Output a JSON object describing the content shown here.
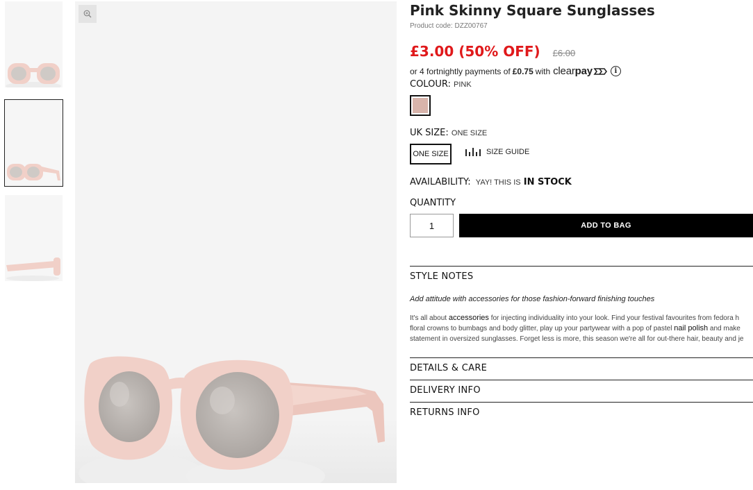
{
  "product": {
    "title": "Pink Skinny Square Sunglasses",
    "code_label": "Product code: DZZ00767",
    "price_now": "£3.00 (50% OFF)",
    "price_was": "£6.00"
  },
  "clearpay": {
    "prefix": "or 4 fortnightly payments of",
    "amount": "£0.75",
    "suffix": "with",
    "brand_light": "clear",
    "brand_bold": "pay",
    "info": "i"
  },
  "colour": {
    "label": "COLOUR:",
    "value": "PINK",
    "swatch_color": "#d8b4ab"
  },
  "size": {
    "label": "UK SIZE:",
    "value": "ONE SIZE",
    "button": "ONE SIZE",
    "guide": "SIZE GUIDE"
  },
  "availability": {
    "label": "AVAILABILITY:",
    "prefix": "YAY! THIS IS",
    "status": "IN STOCK"
  },
  "quantity": {
    "label": "QUANTITY",
    "value": "1"
  },
  "add_to_bag": "ADD TO BAG",
  "style_notes": {
    "heading": "STYLE NOTES",
    "lead": "Add attitude with accessories for those fashion-forward finishing touches",
    "line1_a": "It's all about",
    "line1_link": "accessories",
    "line1_b": "for injecting individuality into your look. Find your festival favourites from fedora h",
    "line2_a": "floral crowns to bumbags and body glitter, play up your partywear with a pop of pastel",
    "line2_link": "nail polish",
    "line2_b": "and make",
    "line3": "statement in oversized sunglasses. Forget less is more, this season we're all for out-there hair, beauty and je"
  },
  "sections": {
    "details": "DETAILS & CARE",
    "delivery": "DELIVERY INFO",
    "returns": "RETURNS INFO"
  },
  "colors": {
    "sale_red": "#e0191b",
    "frame_pink": "#f1d0c8",
    "image_bg": "#f4f4f4"
  },
  "icons": {
    "zoom": "zoom-in-icon",
    "size_guide": "ruler-icon",
    "clearpay_info": "info-icon"
  }
}
